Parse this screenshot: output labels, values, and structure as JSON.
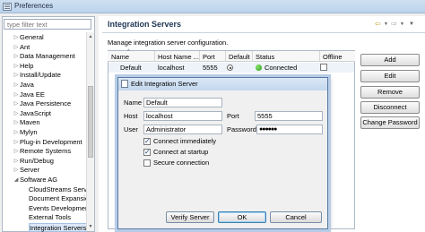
{
  "window": {
    "title": "Preferences",
    "icon": "preferences-icon"
  },
  "filter": {
    "placeholder": "type filter text"
  },
  "tree": [
    {
      "label": "General",
      "expandable": true
    },
    {
      "label": "Ant",
      "expandable": true
    },
    {
      "label": "Data Management",
      "expandable": true
    },
    {
      "label": "Help",
      "expandable": true
    },
    {
      "label": "Install/Update",
      "expandable": true
    },
    {
      "label": "Java",
      "expandable": true
    },
    {
      "label": "Java EE",
      "expandable": true
    },
    {
      "label": "Java Persistence",
      "expandable": true
    },
    {
      "label": "JavaScript",
      "expandable": true
    },
    {
      "label": "Maven",
      "expandable": true
    },
    {
      "label": "Mylyn",
      "expandable": true
    },
    {
      "label": "Plug-in Development",
      "expandable": true
    },
    {
      "label": "Remote Systems",
      "expandable": true
    },
    {
      "label": "Run/Debug",
      "expandable": true
    },
    {
      "label": "Server",
      "expandable": true
    },
    {
      "label": "Software AG",
      "expandable": true,
      "expanded": true
    },
    {
      "label": "CloudStreams Serve",
      "child": true
    },
    {
      "label": "Document Expansio",
      "child": true
    },
    {
      "label": "Events Development",
      "child": true
    },
    {
      "label": "External Tools",
      "child": true
    },
    {
      "label": "Integration Servers",
      "child": true,
      "selected": true
    }
  ],
  "page": {
    "title": "Integration Servers",
    "description": "Manage integration server configuration.",
    "nav_icons": [
      "back-arrow-icon",
      "dropdown-icon",
      "forward-arrow-icon",
      "dropdown-icon",
      "menu-icon"
    ]
  },
  "table": {
    "columns": [
      "Name",
      "Host Name ...",
      "Port",
      "Default",
      "Status",
      "Offline"
    ],
    "rows": [
      {
        "name": "Default",
        "host": "localhost",
        "port": "5555",
        "default": true,
        "status": "Connected",
        "offline": false
      }
    ]
  },
  "buttons": {
    "add": "Add",
    "edit": "Edit",
    "remove": "Remove",
    "disconnect": "Disconnect",
    "change_password": "Change Password"
  },
  "dialog": {
    "title": "Edit Integration Server",
    "name_label": "Name",
    "name_value": "Default",
    "host_label": "Host",
    "host_value": "localhost",
    "port_label": "Port",
    "port_value": "5555",
    "user_label": "User",
    "user_value": "Administrator",
    "password_label": "Password",
    "password_value": "●●●●●●",
    "connect_immediately": {
      "label": "Connect immediately",
      "checked": true
    },
    "connect_at_startup": {
      "label": "Connect at startup",
      "checked": true
    },
    "secure_connection": {
      "label": "Secure connection",
      "checked": false
    },
    "verify_label": "Verify Server",
    "ok_label": "OK",
    "cancel_label": "Cancel"
  }
}
